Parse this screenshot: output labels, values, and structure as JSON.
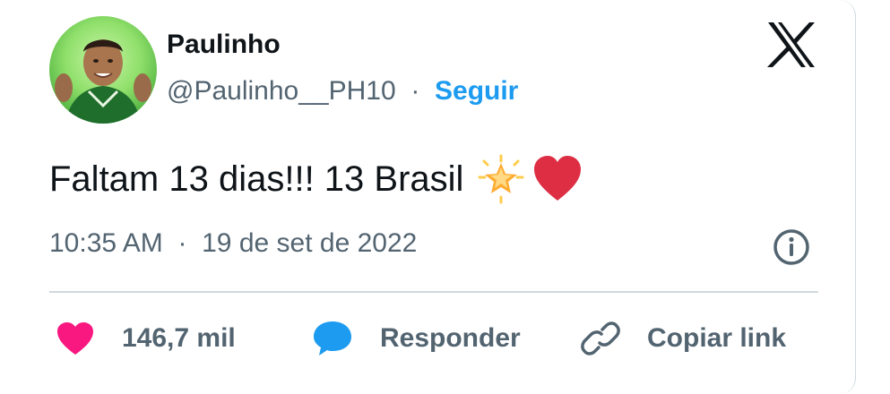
{
  "author": {
    "name": "Paulinho",
    "handle": "@Paulinho__PH10",
    "separator": "·",
    "follow_label": "Seguir"
  },
  "tweet": {
    "text": "Faltam 13 dias!!! 13 Brasil",
    "emojis": [
      "glowing-star",
      "red-heart"
    ]
  },
  "meta": {
    "time": "10:35 AM",
    "separator": "·",
    "date": "19 de set de 2022"
  },
  "actions": {
    "likes": "146,7 mil",
    "reply_label": "Responder",
    "copy_link_label": "Copiar link"
  },
  "icons": {
    "brand": "x-logo-icon",
    "info": "info-icon",
    "like": "heart-icon",
    "reply": "speech-bubble-icon",
    "copy": "link-icon"
  },
  "colors": {
    "link_blue": "#1d9bf0",
    "secondary_text": "#536471",
    "primary_text": "#0f1419",
    "like_pink": "#f91880",
    "heart_red": "#dd2e44",
    "divider": "#cfd9de"
  }
}
